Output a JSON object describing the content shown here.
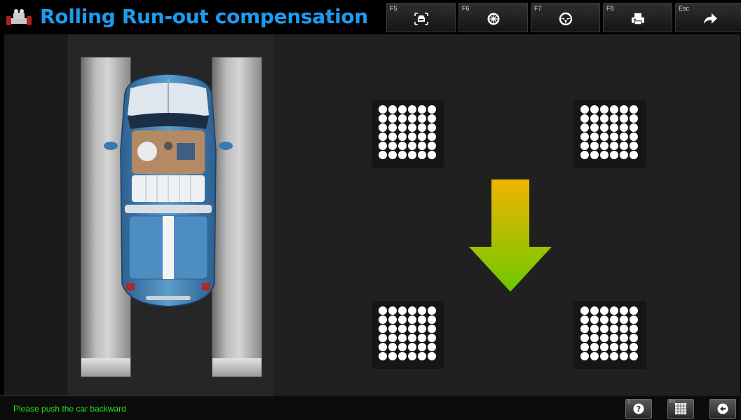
{
  "header": {
    "title": "Rolling Run-out compensation",
    "logo_icon": "alignment-machine-icon",
    "function_keys": [
      {
        "key": "F5",
        "icon": "car-front-view-icon"
      },
      {
        "key": "F6",
        "icon": "wheel-icon"
      },
      {
        "key": "F7",
        "icon": "steering-wheel-icon"
      },
      {
        "key": "F8",
        "icon": "printer-icon"
      },
      {
        "key": "Esc",
        "icon": "forward-arrow-icon"
      }
    ]
  },
  "main": {
    "instruction_arrow": {
      "direction": "down",
      "color_top": "#f0b400",
      "color_bottom": "#6cc900"
    },
    "targets": [
      "front-left",
      "front-right",
      "rear-left",
      "rear-right"
    ]
  },
  "statusbar": {
    "message": "Please push the car backward",
    "message_color": "#23e023",
    "buttons": [
      {
        "key": "1",
        "icon": "help-icon"
      },
      {
        "key": "F2",
        "icon": "grid-icon"
      },
      {
        "key": "",
        "icon": "back-arrow-icon"
      }
    ]
  },
  "colors": {
    "title": "#1e9bf0",
    "background": "#202020"
  }
}
